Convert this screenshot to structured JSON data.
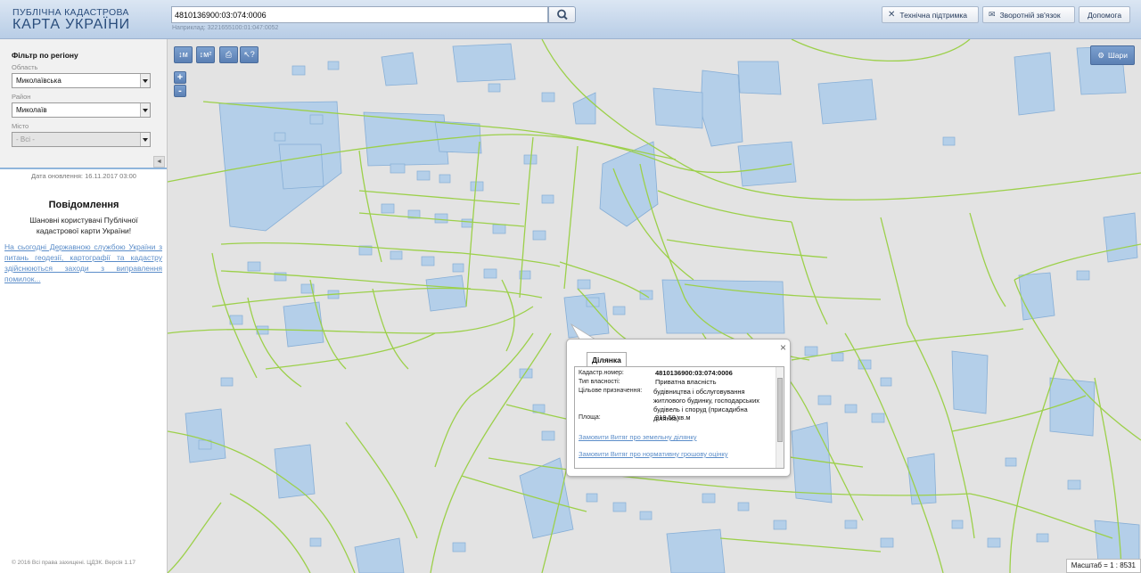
{
  "header": {
    "brand_small": "ПУБЛІЧНА КАДАСТРОВА",
    "brand_big": "КАРТА УКРАЇНИ",
    "search_value": "4810136900:03:074:0006",
    "search_hint": "Наприклад: 3221655100:01:047:0052",
    "tech_support": "Технічна підтримка",
    "feedback": "Зворотній зв'язок",
    "help": "Допомога"
  },
  "sidebar": {
    "filter_title": "Фільтр по регіону",
    "oblast_label": "Область",
    "oblast_value": "Миколаївська",
    "rayon_label": "Район",
    "rayon_value": "Миколаїв",
    "misto_label": "Місто",
    "misto_value": "- Всі -",
    "collapse": "◄",
    "update_date": "Дата оновлення: 16.11.2017 03:00",
    "notice_title": "Повідомлення",
    "notice_greeting": "Шановні користувачі Публічної кадастрової карти України!",
    "notice_link": "На сьогодні Державною службою України з питань геодезії, картографії та кадастру здійснюються заходи з виправлення помилок...",
    "copyright": "© 2016 Всі права захищені. ЦДЗК. Версія 1.17"
  },
  "map": {
    "tool_measure_length": "↕м",
    "tool_measure_area": "↕м²",
    "tool_print": "⎙",
    "tool_info": "↖?",
    "zoom_in": "+",
    "zoom_out": "-",
    "layers": "Шари",
    "scale": "Масштаб = 1 : 8531"
  },
  "popup": {
    "close": "×",
    "tab": "Ділянка",
    "cadnum_label": "Кадастр.номер:",
    "cadnum_value": "4810136900:03:074:0006",
    "ownership_label": "Тип власності:",
    "ownership_value": "Приватна власність",
    "purpose_label": "Цільове призначення:",
    "purpose_value": "будівництва і обслуговування житлового будинку, господарських будівель і споруд (присадибна ділянка)",
    "area_label": "Площа:",
    "area_value": "919.58 кв.м",
    "link_extract": "Замовити Витяг про земельну ділянку",
    "link_valuation": "Замовити Витяг про нормативну грошову оцінку"
  },
  "colors": {
    "parcel_fill": "#b4cfe9",
    "parcel_stroke": "#86aed6",
    "boundary": "#9cd04a",
    "accent": "#5b80b4"
  }
}
